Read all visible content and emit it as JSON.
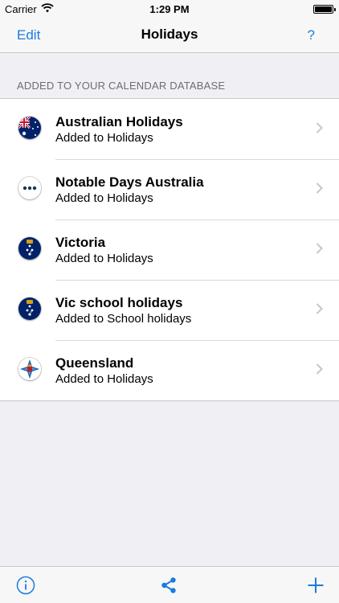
{
  "status_bar": {
    "carrier": "Carrier",
    "time": "1:29 PM"
  },
  "nav": {
    "left": "Edit",
    "title": "Holidays",
    "right": "?"
  },
  "section": {
    "header": "ADDED TO YOUR CALENDAR DATABASE"
  },
  "rows": [
    {
      "title": "Australian Holidays",
      "subtitle": "Added to Holidays",
      "icon": "australia-flag-icon"
    },
    {
      "title": "Notable Days Australia",
      "subtitle": "Added to Holidays",
      "icon": "more-dots-icon"
    },
    {
      "title": "Victoria",
      "subtitle": "Added to Holidays",
      "icon": "victoria-flag-icon"
    },
    {
      "title": "Vic school holidays",
      "subtitle": "Added to School holidays",
      "icon": "victoria-flag-icon"
    },
    {
      "title": "Queensland",
      "subtitle": "Added to Holidays",
      "icon": "queensland-badge-icon"
    }
  ],
  "toolbar": {
    "left_icon": "info-icon",
    "center_icon": "share-icon",
    "right_icon": "add-icon"
  },
  "colors": {
    "accent": "#1a7bdc",
    "background": "#efeff4",
    "flag_navy": "#012169"
  }
}
